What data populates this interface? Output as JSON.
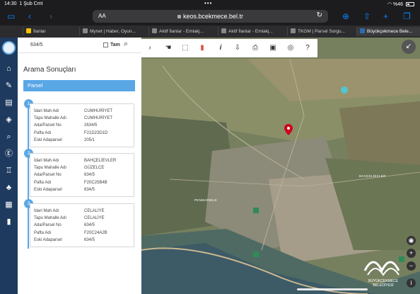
{
  "status_bar": {
    "time": "14:30",
    "date": "1 Şub Cmt",
    "battery": "%46"
  },
  "browser": {
    "aa_label": "AA",
    "url": "keos.bcekmece.bel.tr",
    "tabs": [
      {
        "label": "İlanlar",
        "fav_color": "#f5c400"
      },
      {
        "label": "Mynet | Haber, Oyun...",
        "fav_color": "#888888"
      },
      {
        "label": "Aktif İlanlar - Emlakj...",
        "fav_color": "#888888"
      },
      {
        "label": "Aktif İlanlar - Emlakj...",
        "fav_color": "#888888"
      },
      {
        "label": "TKGM | Parsel Sorgu...",
        "fav_color": "#888888"
      },
      {
        "label": "Büyükçekmece Bele...",
        "fav_color": "#2b6cb0"
      }
    ]
  },
  "rail": {
    "icons": [
      "home-icon",
      "pencil-icon",
      "document-icon",
      "layers-icon",
      "search-icon",
      "e-icon",
      "building-icon",
      "tree-icon",
      "calendar-icon",
      "clipboard-icon"
    ]
  },
  "search": {
    "value": "634/5",
    "checkbox_label": "Tam"
  },
  "results": {
    "title": "Arama Sonuçları",
    "section": "Parsel",
    "field_labels": [
      "İdari Mah Adı",
      "Tapu Mahalle Adı",
      "Ada/Parsel No",
      "Pafta Adı",
      "Eski Adaparsel"
    ],
    "items": [
      {
        "num": "1",
        "values": [
          "CUMHURİYET",
          "CUMHURİYET",
          "2634/5",
          "F21D23D1D",
          "205/1"
        ]
      },
      {
        "num": "2",
        "values": [
          "BAHÇELİEVLER",
          "GÜZELCE",
          "634/5",
          "F20C25B4B",
          "634/5"
        ]
      },
      {
        "num": "3",
        "values": [
          "CELALİYE",
          "CELALİYE",
          "634/5",
          "F20C24A2B",
          "634/5"
        ]
      }
    ]
  },
  "map": {
    "labels": [
      "BAHÇELİEVLER",
      "PENMARBİLE"
    ],
    "watermark": "BÜYÜKÇEKMECE BELEDİYESİ"
  },
  "colors": {
    "accent": "#5aa7e6",
    "rail": "#1e3a5f",
    "marker": "#d0021b"
  }
}
